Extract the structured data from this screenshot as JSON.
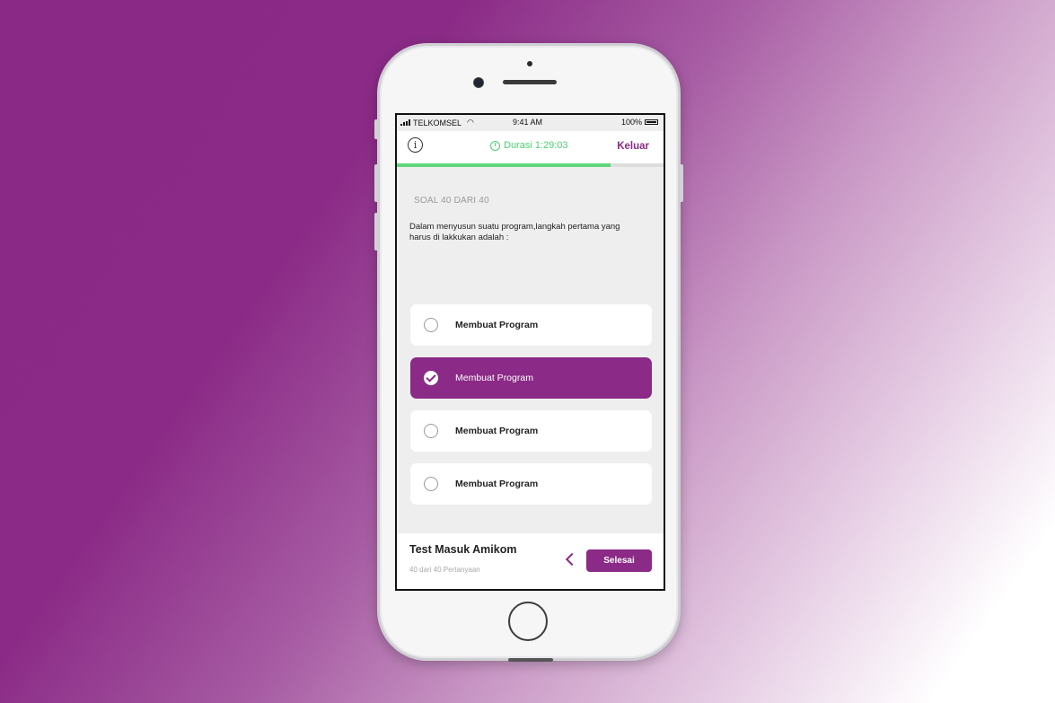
{
  "status_bar": {
    "carrier": "TELKOMSEL",
    "time": "9:41 AM",
    "battery": "100%"
  },
  "header": {
    "duration": "Durasi 1:29:03",
    "exit_label": "Keluar",
    "info_icon": "info-icon"
  },
  "progress": {
    "fraction": 0.8
  },
  "question": {
    "label": "SOAL 40 DARI 40",
    "text": "Dalam menyusun suatu program,langkah pertama yang harus di lakkukan adalah :"
  },
  "options": [
    {
      "label": "Membuat Program",
      "selected": false
    },
    {
      "label": "Membuat Program",
      "selected": true
    },
    {
      "label": "Membuat Program",
      "selected": false
    },
    {
      "label": "Membuat Program",
      "selected": false
    }
  ],
  "footer": {
    "title": "Test Masuk Amikom",
    "subtitle": "40 dari 40 Pertanyaan",
    "finish_label": "Selesai"
  },
  "colors": {
    "accent": "#8b2a87",
    "timer": "#4cd16f",
    "progress": "#5dd67a"
  }
}
